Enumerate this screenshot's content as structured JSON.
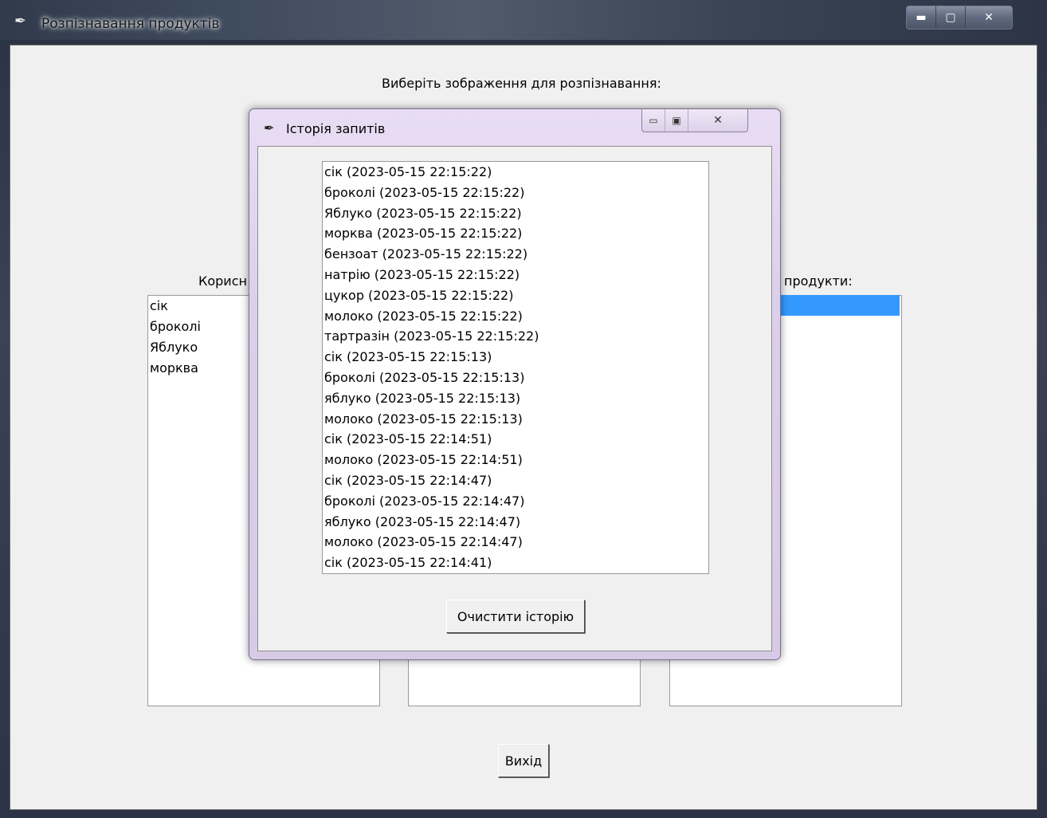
{
  "main_window": {
    "title": "Розпізнавання продуктів",
    "controls": {
      "minimize": "▬",
      "maximize": "▢",
      "close": "✕"
    },
    "prompt": "Виберіть зображення для розпізнавання:",
    "left_column": {
      "label": "Корисн",
      "items": [
        "сік",
        "броколі",
        "Яблуко",
        "морква"
      ]
    },
    "right_column": {
      "label": "продукти:"
    },
    "exit_button": "Вихід"
  },
  "history_dialog": {
    "title": "Історія запитів",
    "controls": {
      "minimize": "▭",
      "maximize": "▣",
      "close": "✕"
    },
    "entries": [
      "сік (2023-05-15 22:15:22)",
      "броколі (2023-05-15 22:15:22)",
      "Яблуко (2023-05-15 22:15:22)",
      "морква (2023-05-15 22:15:22)",
      "бензоат (2023-05-15 22:15:22)",
      "натрію (2023-05-15 22:15:22)",
      "цукор (2023-05-15 22:15:22)",
      "молоко (2023-05-15 22:15:22)",
      "тартразін (2023-05-15 22:15:22)",
      "сік (2023-05-15 22:15:13)",
      "броколі (2023-05-15 22:15:13)",
      "яблуко (2023-05-15 22:15:13)",
      "молоко (2023-05-15 22:15:13)",
      "сік (2023-05-15 22:14:51)",
      "молоко (2023-05-15 22:14:51)",
      "сік (2023-05-15 22:14:47)",
      "броколі (2023-05-15 22:14:47)",
      "яблуко (2023-05-15 22:14:47)",
      "молоко (2023-05-15 22:14:47)",
      "сік (2023-05-15 22:14:41)"
    ],
    "clear_button": "Очистити історію"
  },
  "colors": {
    "selection": "#3399ff",
    "client_bg": "#f0f0f0",
    "dialog_frame": "#dccfea"
  }
}
